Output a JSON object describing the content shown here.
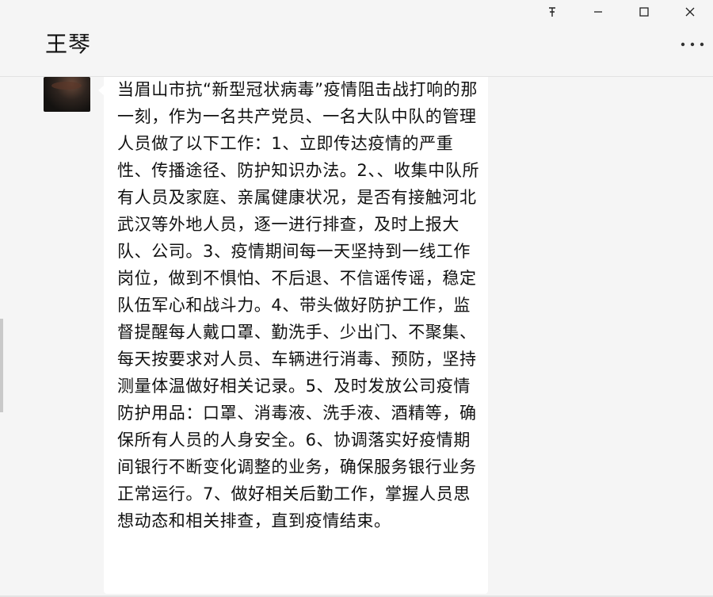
{
  "window": {
    "controls": {
      "pin": "ꟷ",
      "pin_label": "pin-icon",
      "minimize": "–",
      "maximize": "☐",
      "close": "✕"
    },
    "more_label": "…"
  },
  "header": {
    "title": "王琴"
  },
  "message": {
    "sender_avatar": "avatar-image",
    "text": "当眉山市抗“新型冠状病毒”疫情阻击战打响的那一刻，作为一名共产党员、一名大队中队的管理人员做了以下工作：1、立即传达疫情的严重性、传播途径、防护知识办法。2、、收集中队所有人员及家庭、亲属健康状况，是否有接触河北武汉等外地人员，逐一进行排查，及时上报大队、公司。3、疫情期间每一天坚持到一线工作岗位，做到不惧怕、不后退、不信谣传谣，稳定队伍军心和战斗力。4、带头做好防护工作，监督提醒每人戴口罩、勤洗手、少出门、不聚集、每天按要求对人员、车辆进行消毒、预防，坚持测量体温做好相关记录。5、及时发放公司疫情防护用品：口罩、消毒液、洗手液、酒精等，确保所有人员的人身安全。6、协调落实好疫情期间银行不断变化调整的业务，确保服务银行业务正常运行。7、做好相关后勤工作，掌握人员思想动态和相关排查，直到疫情结束。"
  }
}
